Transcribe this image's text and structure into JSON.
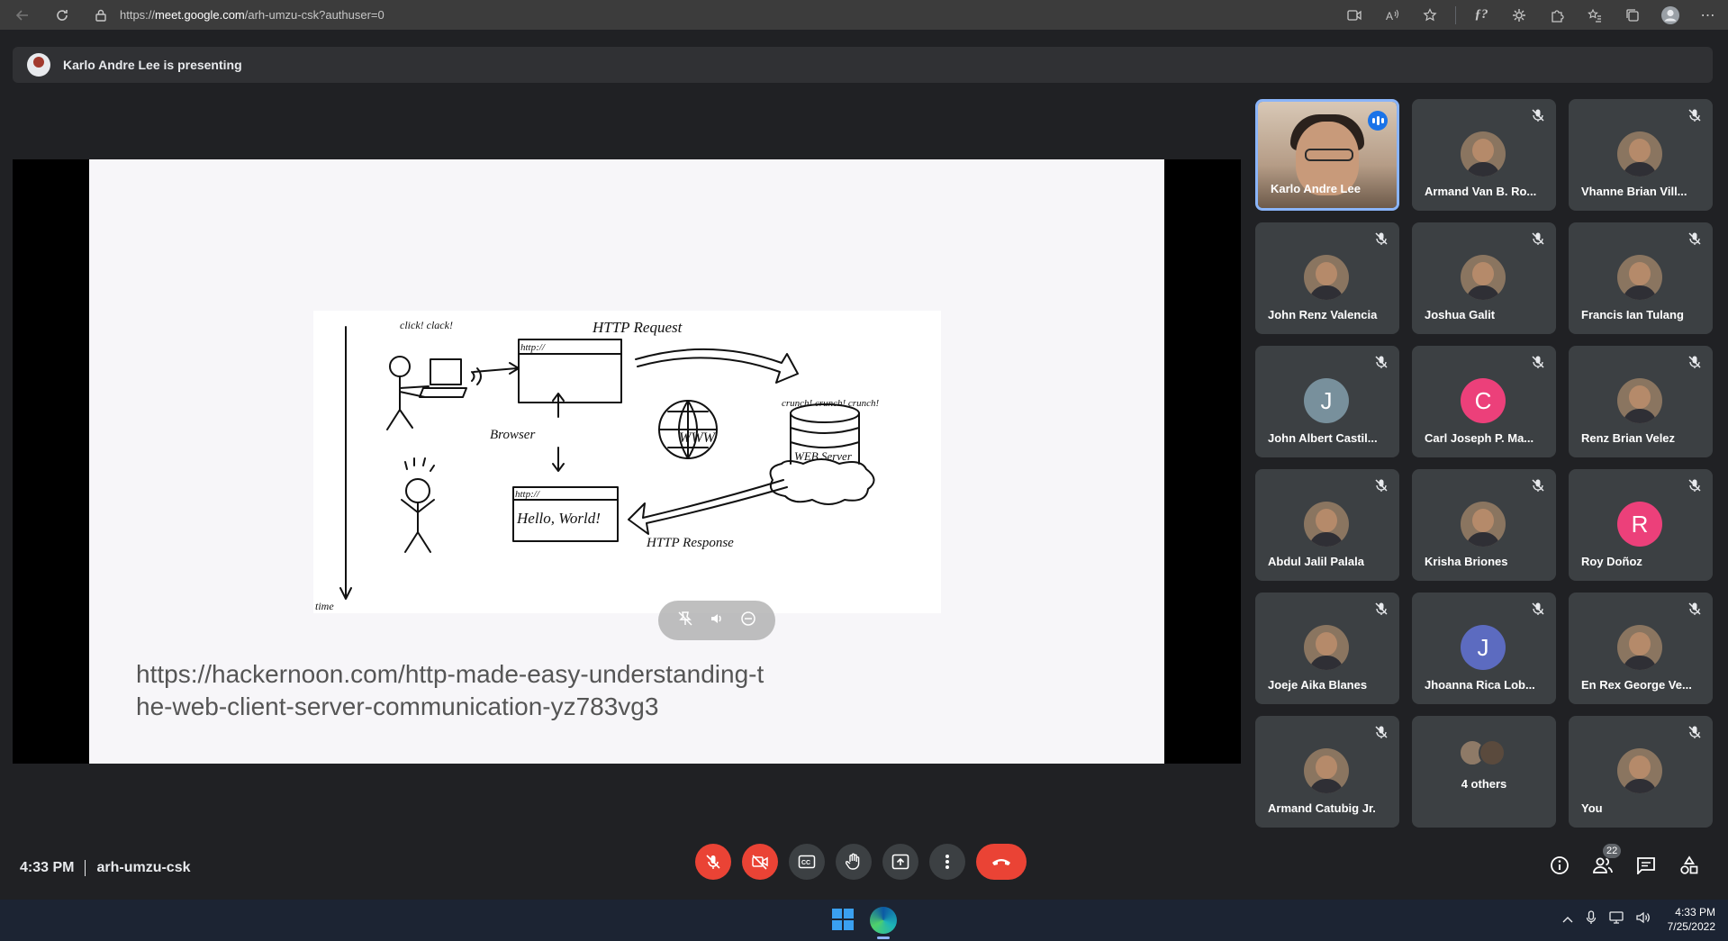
{
  "browser": {
    "url_scheme": "https://",
    "url_host": "meet.google.com",
    "url_path": "/arh-umzu-csk?authuser=0"
  },
  "banner": {
    "text": "Karlo Andre Lee is presenting"
  },
  "slide": {
    "url_text_line1": "https://hackernoon.com/http-made-easy-understanding-t",
    "url_text_line2": "he-web-client-server-communication-yz783vg3",
    "diagram": {
      "click_clack": "click! clack!",
      "http_box_top": "http://",
      "http_request": "HTTP Request",
      "browser": "Browser",
      "www": "WWW",
      "crunch": "crunch! crunch! crunch!",
      "web_server": "WEB Server",
      "http_box_bottom": "http://",
      "hello_world": "Hello, World!",
      "http_response": "HTTP Response",
      "time": "time"
    }
  },
  "participants": [
    {
      "name": "Karlo Andre Lee",
      "type": "video",
      "speaking": true
    },
    {
      "name": "Armand Van B. Ro...",
      "type": "photo"
    },
    {
      "name": "Vhanne Brian Vill...",
      "type": "photo"
    },
    {
      "name": "John Renz Valencia",
      "type": "photo"
    },
    {
      "name": "Joshua Galit",
      "type": "photo"
    },
    {
      "name": "Francis Ian Tulang",
      "type": "photo"
    },
    {
      "name": "John Albert Castil...",
      "type": "letter",
      "letter": "J",
      "color": "#78909c"
    },
    {
      "name": "Carl Joseph P. Ma...",
      "type": "letter",
      "letter": "C",
      "color": "#ec407a"
    },
    {
      "name": "Renz Brian Velez",
      "type": "photo"
    },
    {
      "name": "Abdul Jalil Palala",
      "type": "photo"
    },
    {
      "name": "Krisha Briones",
      "type": "photo"
    },
    {
      "name": "Roy Doñoz",
      "type": "letter",
      "letter": "R",
      "color": "#ec407a"
    },
    {
      "name": "Joeje Aika Blanes",
      "type": "photo"
    },
    {
      "name": "Jhoanna Rica Lob...",
      "type": "letter",
      "letter": "J",
      "color": "#5c6bc0"
    },
    {
      "name": "En Rex George Ve...",
      "type": "photo"
    },
    {
      "name": "Armand Catubig Jr.",
      "type": "photo"
    },
    {
      "name": "4 others",
      "type": "others"
    },
    {
      "name": "You",
      "type": "photo"
    }
  ],
  "meeting": {
    "time": "4:33 PM",
    "code": "arh-umzu-csk",
    "people_count": "22"
  },
  "colors": {
    "background": "#202124",
    "tile": "#3c4043",
    "danger": "#ea4335",
    "active_border": "#8ab4f8"
  },
  "taskbar": {
    "time": "4:33 PM",
    "date": "7/25/2022"
  }
}
